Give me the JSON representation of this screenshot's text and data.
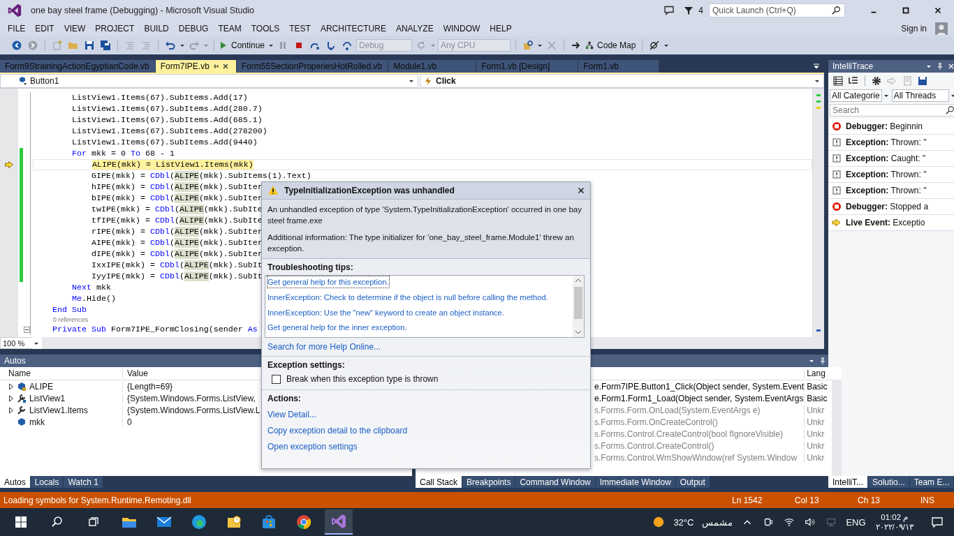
{
  "window": {
    "title": "one bay steel frame (Debugging) - Microsoft Visual Studio",
    "notification_count": "4",
    "quick_launch": {
      "placeholder": "Quick Launch (Ctrl+Q)"
    }
  },
  "menu": {
    "items": [
      "FILE",
      "EDIT",
      "VIEW",
      "PROJECT",
      "BUILD",
      "DEBUG",
      "TEAM",
      "TOOLS",
      "TEST",
      "ARCHITECTURE",
      "ANALYZE",
      "WINDOW",
      "HELP"
    ],
    "sign_in": "Sign in"
  },
  "toolbar": {
    "continue": "Continue",
    "configuration": "Debug",
    "platform": "Any CPU",
    "code_map": "Code Map"
  },
  "editor": {
    "tabs": [
      {
        "label": "Form9StrainingActionEgyptianCode.vb",
        "selected": false
      },
      {
        "label": "Form7IPE.vb",
        "selected": true
      },
      {
        "label": "Form55SectionProperiesHotRolled.vb",
        "selected": false
      },
      {
        "label": "Module1.vb",
        "selected": false
      },
      {
        "label": "Form1.vb [Design]",
        "selected": false
      },
      {
        "label": "Form1.vb",
        "selected": false
      }
    ],
    "type_dropdown": "Button1",
    "member_dropdown": "Click",
    "lines": [
      {
        "kind": "code",
        "changed": false,
        "segs": [
          {
            "text": "        ListView1.Items(67).SubItems.Add(17)",
            "kind": "plain"
          }
        ]
      },
      {
        "kind": "code",
        "changed": false,
        "segs": [
          {
            "text": "        ListView1.Items(67).SubItems.Add(280.7)",
            "kind": "plain"
          }
        ]
      },
      {
        "kind": "code",
        "changed": false,
        "segs": [
          {
            "text": "        ListView1.Items(67).SubItems.Add(685.1)",
            "kind": "plain"
          }
        ]
      },
      {
        "kind": "code",
        "changed": false,
        "segs": [
          {
            "text": "        ListView1.Items(67).SubItems.Add(278200)",
            "kind": "plain"
          }
        ]
      },
      {
        "kind": "code",
        "changed": false,
        "segs": [
          {
            "text": "        ListView1.Items(67).SubItems.Add(9440)",
            "kind": "plain"
          }
        ]
      },
      {
        "kind": "code",
        "changed": true,
        "segs": [
          {
            "text": "        For",
            "kind": "keyword"
          },
          {
            "text": " mkk = 0 ",
            "kind": "plain"
          },
          {
            "text": "To",
            "kind": "keyword"
          },
          {
            "text": " 68 - 1",
            "kind": "plain"
          }
        ]
      },
      {
        "kind": "current",
        "changed": true,
        "segs": [
          {
            "text": "            ALIPE(mkk) = ListView1.Items(mkk)",
            "kind": "current"
          }
        ]
      },
      {
        "kind": "code",
        "changed": true,
        "segs": [
          {
            "text": "            GIPE(mkk) = ",
            "kind": "plain"
          },
          {
            "text": "CDbl",
            "kind": "keyword"
          },
          {
            "text": "(",
            "kind": "plain"
          },
          {
            "text": "ALIPE",
            "kind": "reference"
          },
          {
            "text": "(mkk).SubItems(1).Text)",
            "kind": "plain"
          }
        ]
      },
      {
        "kind": "code",
        "changed": true,
        "segs": [
          {
            "text": "            hIPE(mkk) = ",
            "kind": "plain"
          },
          {
            "text": "CDbl",
            "kind": "keyword"
          },
          {
            "text": "(",
            "kind": "plain"
          },
          {
            "text": "ALIPE",
            "kind": "reference"
          },
          {
            "text": "(mkk).SubIter",
            "kind": "plain"
          }
        ]
      },
      {
        "kind": "code",
        "changed": true,
        "segs": [
          {
            "text": "            bIPE(mkk) = ",
            "kind": "plain"
          },
          {
            "text": "CDbl",
            "kind": "keyword"
          },
          {
            "text": "(",
            "kind": "plain"
          },
          {
            "text": "ALIPE",
            "kind": "reference"
          },
          {
            "text": "(mkk).SubIter",
            "kind": "plain"
          }
        ]
      },
      {
        "kind": "code",
        "changed": true,
        "segs": [
          {
            "text": "            twIPE(mkk) = ",
            "kind": "plain"
          },
          {
            "text": "CDbl",
            "kind": "keyword"
          },
          {
            "text": "(",
            "kind": "plain"
          },
          {
            "text": "ALIPE",
            "kind": "reference"
          },
          {
            "text": "(mkk).SubIte",
            "kind": "plain"
          }
        ]
      },
      {
        "kind": "code",
        "changed": true,
        "segs": [
          {
            "text": "            tfIPE(mkk) = ",
            "kind": "plain"
          },
          {
            "text": "CDbl",
            "kind": "keyword"
          },
          {
            "text": "(",
            "kind": "plain"
          },
          {
            "text": "ALIPE",
            "kind": "reference"
          },
          {
            "text": "(mkk).SubIte",
            "kind": "plain"
          }
        ]
      },
      {
        "kind": "code",
        "changed": true,
        "segs": [
          {
            "text": "            rIPE(mkk) = ",
            "kind": "plain"
          },
          {
            "text": "CDbl",
            "kind": "keyword"
          },
          {
            "text": "(",
            "kind": "plain"
          },
          {
            "text": "ALIPE",
            "kind": "reference"
          },
          {
            "text": "(mkk).SubIter",
            "kind": "plain"
          }
        ]
      },
      {
        "kind": "code",
        "changed": true,
        "segs": [
          {
            "text": "            AIPE(mkk) = ",
            "kind": "plain"
          },
          {
            "text": "CDbl",
            "kind": "keyword"
          },
          {
            "text": "(",
            "kind": "plain"
          },
          {
            "text": "ALIPE",
            "kind": "reference"
          },
          {
            "text": "(mkk).SubIter",
            "kind": "plain"
          }
        ]
      },
      {
        "kind": "code",
        "changed": true,
        "segs": [
          {
            "text": "            dIPE(mkk) = ",
            "kind": "plain"
          },
          {
            "text": "CDbl",
            "kind": "keyword"
          },
          {
            "text": "(",
            "kind": "plain"
          },
          {
            "text": "ALIPE",
            "kind": "reference"
          },
          {
            "text": "(mkk).SubIter",
            "kind": "plain"
          }
        ]
      },
      {
        "kind": "code",
        "changed": true,
        "segs": [
          {
            "text": "            IxxIPE(mkk) = ",
            "kind": "plain"
          },
          {
            "text": "CDbl",
            "kind": "keyword"
          },
          {
            "text": "(",
            "kind": "plain"
          },
          {
            "text": "ALIPE",
            "kind": "reference"
          },
          {
            "text": "(mkk).SubIt",
            "kind": "plain"
          }
        ]
      },
      {
        "kind": "code",
        "changed": true,
        "segs": [
          {
            "text": "            IyyIPE(mkk) = ",
            "kind": "plain"
          },
          {
            "text": "CDbl",
            "kind": "keyword"
          },
          {
            "text": "(",
            "kind": "plain"
          },
          {
            "text": "ALIPE",
            "kind": "reference"
          },
          {
            "text": "(mkk).SubIt",
            "kind": "plain"
          }
        ]
      },
      {
        "kind": "code",
        "changed": false,
        "segs": [
          {
            "text": "        Next",
            "kind": "keyword"
          },
          {
            "text": " mkk",
            "kind": "plain"
          }
        ]
      },
      {
        "kind": "code",
        "changed": false,
        "segs": [
          {
            "text": "        Me",
            "kind": "keyword"
          },
          {
            "text": ".Hide()",
            "kind": "plain"
          }
        ]
      },
      {
        "kind": "code",
        "changed": false,
        "segs": [
          {
            "text": "    End Sub",
            "kind": "keyword"
          }
        ]
      },
      {
        "kind": "lens",
        "changed": false,
        "segs": [
          {
            "text": "0 references",
            "kind": "plain"
          }
        ]
      },
      {
        "kind": "member",
        "changed": false,
        "segs": [
          {
            "text": "    Private Sub",
            "kind": "keyword"
          },
          {
            "text": " Form7IPE_FormClosing(sender ",
            "kind": "plain"
          },
          {
            "text": "As",
            "kind": "keyword"
          }
        ]
      }
    ],
    "zoom": "100 %"
  },
  "intellitrace": {
    "title": "IntelliTrace",
    "category_filter": "All Categorie",
    "thread_filter": "All Threads",
    "search": {
      "placeholder": "Search"
    },
    "events": [
      {
        "kind": "debugger",
        "label": "Debugger:",
        "text": "Beginnin"
      },
      {
        "kind": "exception",
        "label": "Exception:",
        "text": "Thrown: \""
      },
      {
        "kind": "exception",
        "label": "Exception:",
        "text": "Caught: \""
      },
      {
        "kind": "exception",
        "label": "Exception:",
        "text": "Thrown: \""
      },
      {
        "kind": "exception",
        "label": "Exception:",
        "text": "Thrown: \""
      },
      {
        "kind": "debugger",
        "label": "Debugger:",
        "text": "Stopped a"
      },
      {
        "kind": "live",
        "label": "Live Event:",
        "text": "Exceptio"
      }
    ],
    "tabs": [
      {
        "label": "IntelliT...",
        "selected": true
      },
      {
        "label": "Solutio...",
        "selected": false
      },
      {
        "label": "Team E...",
        "selected": false
      }
    ]
  },
  "autos": {
    "title": "Autos",
    "columns": [
      "Name",
      "Value"
    ],
    "rows": [
      {
        "kind": "field",
        "has_children": true,
        "name": "ALIPE",
        "value": "{Length=69}"
      },
      {
        "kind": "control",
        "has_children": true,
        "name": "ListView1",
        "value": "{System.Windows.Forms.ListView,"
      },
      {
        "kind": "property",
        "has_children": true,
        "name": "ListView1.Items",
        "value": "{System.Windows.Forms.ListView.L"
      },
      {
        "kind": "local",
        "has_children": false,
        "name": "mkk",
        "value": "0"
      }
    ],
    "tabs": [
      {
        "label": "Autos",
        "selected": true
      },
      {
        "label": "Locals",
        "selected": false
      },
      {
        "label": "Watch 1",
        "selected": false
      }
    ]
  },
  "call_stack": {
    "columns": [
      "Lang"
    ],
    "rows": [
      {
        "kind": "user",
        "name": "e.Form7IPE.Button1_Click(Object sender, System.Event",
        "language": "Basic"
      },
      {
        "kind": "user",
        "name": "e.Form1.Form1_Load(Object sender, System.EventArgs",
        "language": "Basic"
      },
      {
        "kind": "external",
        "name": "s.Forms.Form.OnLoad(System.EventArgs e)",
        "language": "Unkr"
      },
      {
        "kind": "external",
        "name": "s.Forms.Form.OnCreateControl()",
        "language": "Unkr"
      },
      {
        "kind": "external",
        "name": "s.Forms.Control.CreateControl(bool fIgnoreVisible)",
        "language": "Unkr"
      },
      {
        "kind": "external",
        "name": "s.Forms.Control.CreateControl()",
        "language": "Unkr"
      },
      {
        "kind": "external",
        "name": "s.Forms.Control.WmShowWindow(ref System.Window",
        "language": "Unkr"
      }
    ],
    "tabs": [
      {
        "label": "Call Stack",
        "selected": true
      },
      {
        "label": "Breakpoints",
        "selected": false
      },
      {
        "label": "Command Window",
        "selected": false
      },
      {
        "label": "Immediate Window",
        "selected": false
      },
      {
        "label": "Output",
        "selected": false
      }
    ]
  },
  "exception_dialog": {
    "title": "TypeInitializationException was unhandled",
    "message": "An unhandled exception of type 'System.TypeInitializationException' occurred in one bay steel frame.exe",
    "additional_info": "Additional information: The type initializer for 'one_bay_steel_frame.Module1' threw an exception.",
    "tips_heading": "Troubleshooting tips:",
    "tips": [
      "Get general help for this exception.",
      "InnerException: Check to determine if the object is null before calling the method.",
      "InnerException: Use the \"new\" keyword to create an object instance.",
      "Get general help for the inner exception."
    ],
    "search_online": "Search for more Help Online...",
    "settings_heading": "Exception settings:",
    "break_option": {
      "label": "Break when this exception type is thrown",
      "checked": false
    },
    "actions_heading": "Actions:",
    "actions": [
      "View Detail...",
      "Copy exception detail to the clipboard",
      "Open exception settings"
    ]
  },
  "status_bar": {
    "message": "Loading symbols for System.Runtime.Remoting.dll",
    "line": "Ln 1542",
    "column": "Col 13",
    "char": "Ch 13",
    "mode": "INS"
  },
  "taskbar": {
    "apps": [
      {
        "kind": "explorer",
        "selected": false
      },
      {
        "kind": "mail",
        "selected": false
      },
      {
        "kind": "edge",
        "selected": false
      },
      {
        "kind": "outlook",
        "selected": false
      },
      {
        "kind": "store",
        "selected": false
      },
      {
        "kind": "chrome",
        "selected": false
      },
      {
        "kind": "vs",
        "selected": true
      }
    ],
    "temperature": "32°C",
    "weather": "مشمس",
    "language": "ENG",
    "time": "01:02 م",
    "date": "٢٠٢٢/٠٩/١٣"
  }
}
